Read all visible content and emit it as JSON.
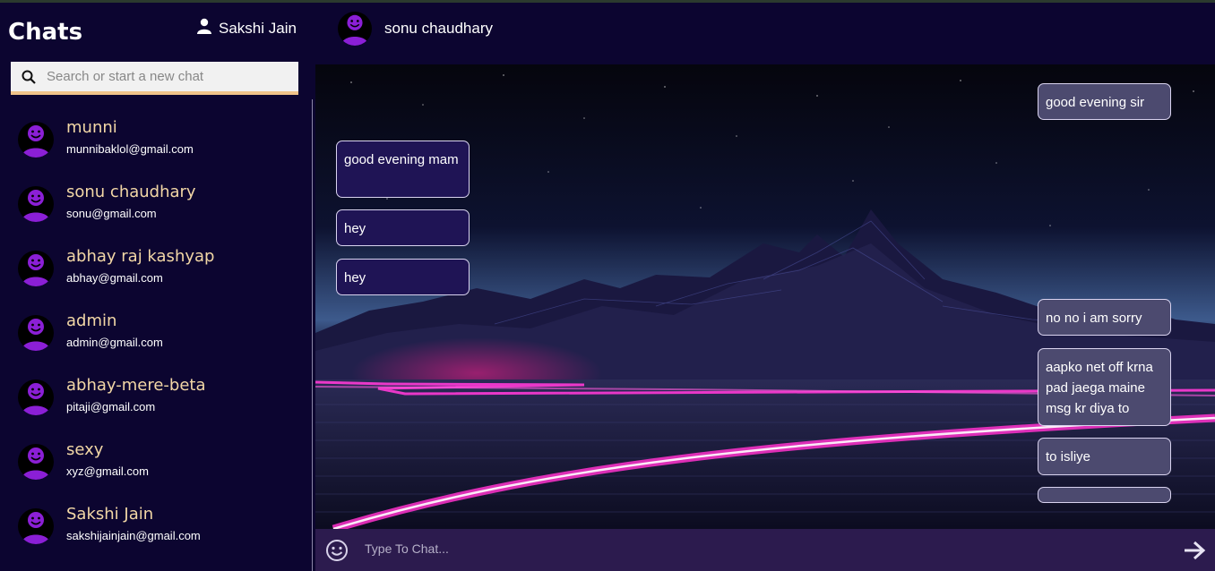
{
  "app": {
    "title": "Chats"
  },
  "header": {
    "current_user": "Sakshi Jain",
    "active_chat": "sonu chaudhary"
  },
  "search": {
    "placeholder": "Search or start a new chat"
  },
  "contacts": [
    {
      "name": "munni",
      "email": "munnibaklol@gmail.com"
    },
    {
      "name": "sonu chaudhary",
      "email": "sonu@gmail.com"
    },
    {
      "name": "abhay raj kashyap",
      "email": "abhay@gmail.com"
    },
    {
      "name": "admin",
      "email": "admin@gmail.com"
    },
    {
      "name": "abhay-mere-beta",
      "email": "pitaji@gmail.com"
    },
    {
      "name": "sexy",
      "email": "xyz@gmail.com"
    },
    {
      "name": "Sakshi Jain",
      "email": "sakshijainjain@gmail.com"
    }
  ],
  "messages": [
    {
      "side": "sent",
      "text": "good evening sir"
    },
    {
      "side": "received",
      "text": "good evening mam"
    },
    {
      "side": "received",
      "text": "hey"
    },
    {
      "side": "received",
      "text": "hey"
    },
    {
      "side": "sent",
      "text": "no no i am sorry"
    },
    {
      "side": "sent",
      "text": "aapko net off krna pad jaega maine msg kr diya to"
    },
    {
      "side": "sent",
      "text": "to isliye"
    },
    {
      "side": "sent",
      "text": ""
    }
  ],
  "composer": {
    "placeholder": "Type To Chat..."
  },
  "icons": {
    "search": "search-icon",
    "user": "user-icon",
    "avatar": "smiley-avatar-icon",
    "emoji": "emoji-icon",
    "send": "send-arrow-icon"
  },
  "colors": {
    "background": "#0c0530",
    "contact_name": "#f2d7a6",
    "avatar_purple": "#8b1fd6",
    "received_bubble": "#1f1455",
    "sent_bubble": "#4c4a6f",
    "composer_bar": "#2c1b4e"
  }
}
